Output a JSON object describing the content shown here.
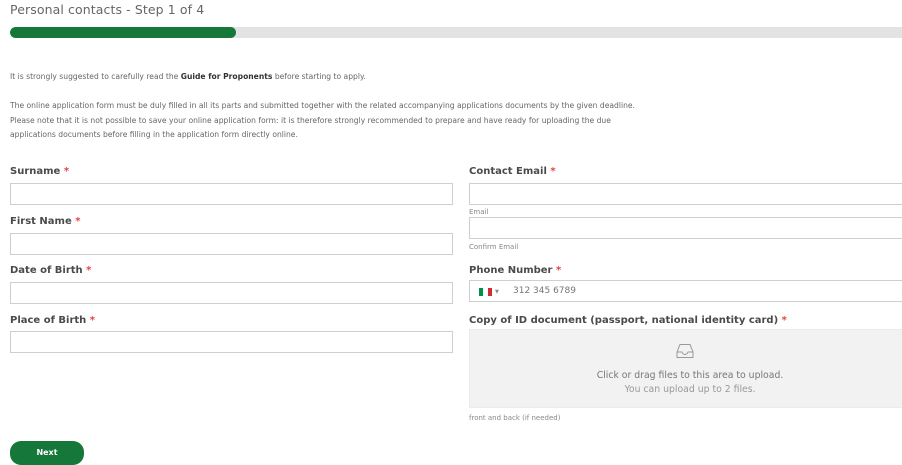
{
  "step_title": "Personal contacts - Step 1 of 4",
  "progress": {
    "value_percent": 25.3,
    "fill_color": "#15783a",
    "track_color": "#e3e3e3"
  },
  "intro": {
    "before": "It is strongly suggested to carefully read the ",
    "link": "Guide for Proponents",
    "after": " before starting to apply.",
    "paragraph_line1": "The online application form must be duly filled in all its parts and submitted together with the related accompanying applications documents by the given deadline.",
    "paragraph_line2": "Please note that it is not possible to save your online application form: it is therefore strongly recommended to prepare and have ready for uploading the due",
    "paragraph_line3": "applications documents before filling in the application form directly online."
  },
  "required_mark": "*",
  "fields": {
    "surname": {
      "label": "Surname",
      "value": ""
    },
    "first_name": {
      "label": "First Name",
      "value": ""
    },
    "date_of_birth": {
      "label": "Date of Birth",
      "value": ""
    },
    "place_of_birth": {
      "label": "Place of Birth",
      "value": ""
    },
    "contact_email": {
      "label": "Contact Email",
      "email_hint": "Email",
      "confirm_hint": "Confirm Email"
    },
    "phone": {
      "label": "Phone Number",
      "placeholder": "312 345 6789",
      "flag_icon": "italy-flag-icon",
      "flag_colors": [
        "#009246",
        "#ffffff",
        "#ce2b37"
      ]
    },
    "id_document": {
      "label": "Copy of ID document (passport, national identity card)",
      "upload_icon": "inbox-icon",
      "dropzone_line1": "Click or drag files to this area to upload.",
      "dropzone_line2": "You can upload up to 2 files.",
      "hint": "front and back (if needed)"
    }
  },
  "next_button": "Next",
  "colors": {
    "accent": "#15783a",
    "required": "#e0453d"
  }
}
